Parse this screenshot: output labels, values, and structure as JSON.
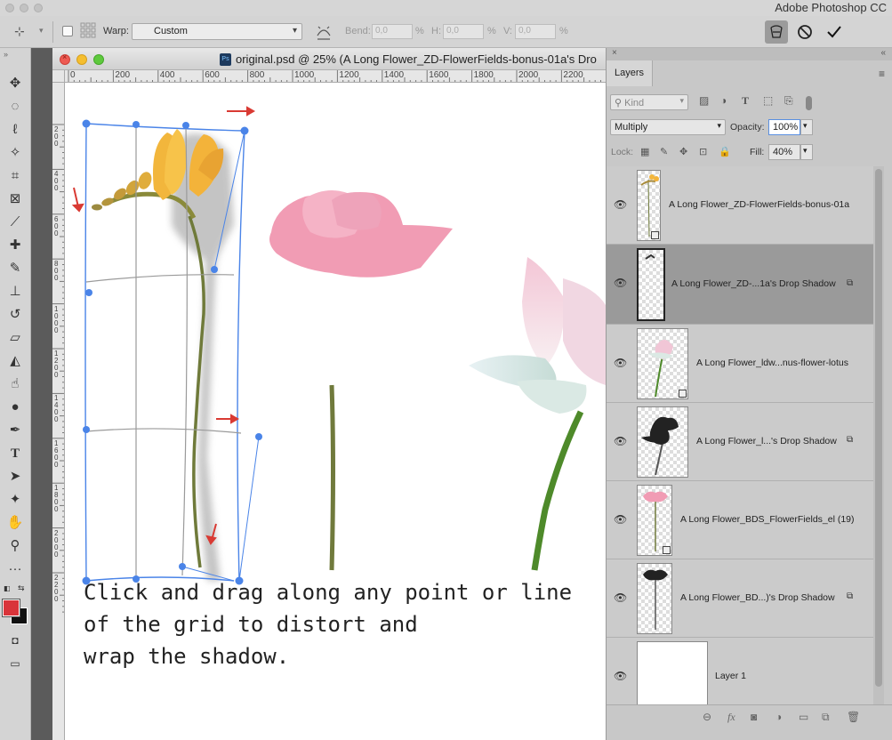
{
  "app": {
    "title": "Adobe Photoshop CC"
  },
  "options_bar": {
    "warp_label": "Warp:",
    "warp_value": "Custom",
    "bend_label": "Bend:",
    "bend_value": "0,0",
    "h_label": "H:",
    "h_value": "0,0",
    "v_label": "V:",
    "v_value": "0,0",
    "percent": "%"
  },
  "document": {
    "title": "original.psd @ 25% (A Long Flower_ZD-FlowerFields-bonus-01a's Dro",
    "ruler_h": [
      "0",
      "200",
      "400",
      "600",
      "800",
      "1000",
      "1200",
      "1400",
      "1600",
      "1800",
      "2000",
      "2200"
    ],
    "ruler_v": [
      "2\n0\n0",
      "4\n0\n0",
      "6\n0\n0",
      "8\n0\n0",
      "1\n0\n0\n0",
      "1\n2\n0\n0",
      "1\n4\n0\n0",
      "1\n6\n0\n0",
      "1\n8\n0\n0",
      "2\n0\n0\n0",
      "2\n2\n0\n0"
    ],
    "caption": [
      "Click and drag along any point or line",
      "of the grid to distort and",
      "wrap the shadow."
    ]
  },
  "colors": {
    "accent": "#4a84e8",
    "arrow": "#d93a33",
    "foreground": "#d9343a",
    "background": "#111111"
  },
  "layers_panel": {
    "tab_label": "Layers",
    "filter_kind": "Kind",
    "blend_mode": "Multiply",
    "opacity_label": "Opacity:",
    "opacity_value": "100%",
    "lock_label": "Lock:",
    "fill_label": "Fill:",
    "fill_value": "40%",
    "layers": [
      {
        "name": "A Long Flower_ZD-FlowerFields-bonus-01a",
        "selected": false
      },
      {
        "name": "A Long Flower_ZD-...1a's Drop Shadow",
        "selected": true
      },
      {
        "name": "A Long Flower_ldw...nus-flower-lotus",
        "selected": false
      },
      {
        "name": "A Long Flower_l...'s Drop Shadow",
        "selected": false
      },
      {
        "name": "A Long Flower_BDS_FlowerFields_el (19)",
        "selected": false
      },
      {
        "name": "A Long Flower_BD...)'s Drop Shadow",
        "selected": false
      },
      {
        "name": "Layer 1",
        "selected": false
      }
    ]
  }
}
